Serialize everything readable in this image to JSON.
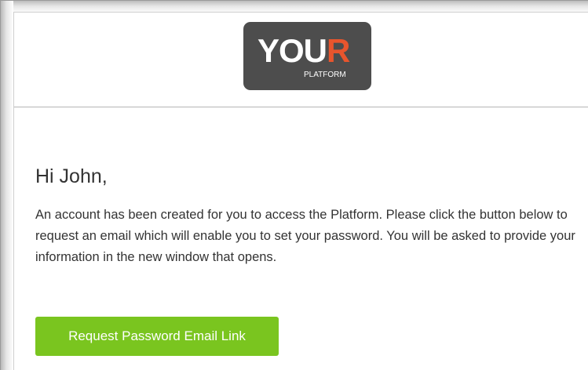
{
  "logo": {
    "word_primary": "YOU",
    "word_accent": "R",
    "subtitle": "PLATFORM"
  },
  "email": {
    "greeting": "Hi John,",
    "message": "An account has been created for you to access the Platform. Please click the button below to request an email which will enable you to set your password. You will be asked to provide your information in the new window that opens.",
    "cta_label": "Request Password Email Link"
  },
  "colors": {
    "logo_background": "#4d4d4d",
    "logo_accent": "#e8552d",
    "cta_background": "#7ac51f",
    "text": "#333333"
  }
}
